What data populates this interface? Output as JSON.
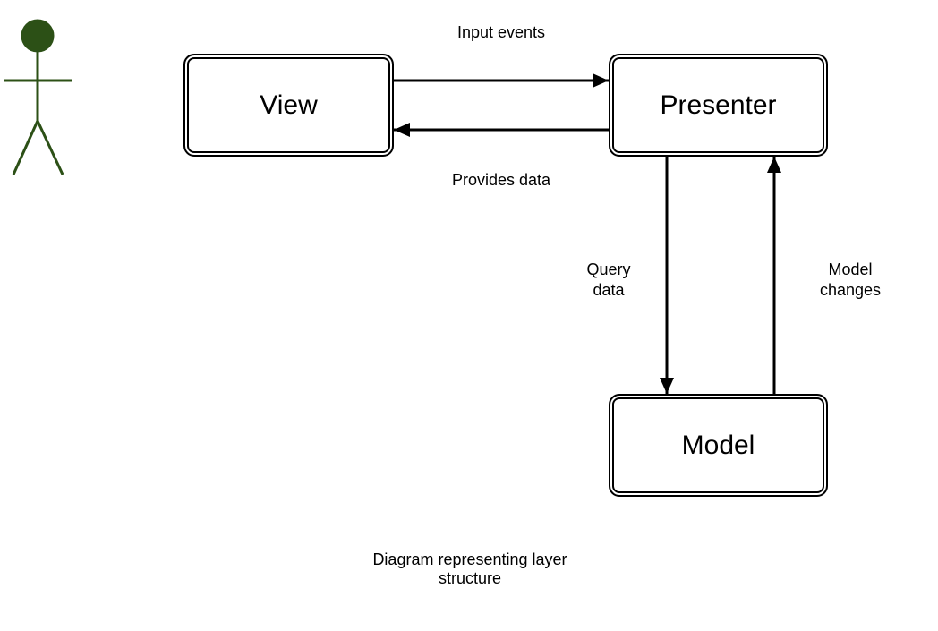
{
  "nodes": {
    "view": "View",
    "presenter": "Presenter",
    "model": "Model"
  },
  "edges": {
    "input_events": "Input events",
    "provides_data": "Provides data",
    "query_data_line1": "Query",
    "query_data_line2": "data",
    "model_changes_line1": "Model",
    "model_changes_line2": "changes"
  },
  "caption_line1": "Diagram representing layer",
  "caption_line2": "structure",
  "actor": {
    "role": "user",
    "color": "#2c5016"
  }
}
